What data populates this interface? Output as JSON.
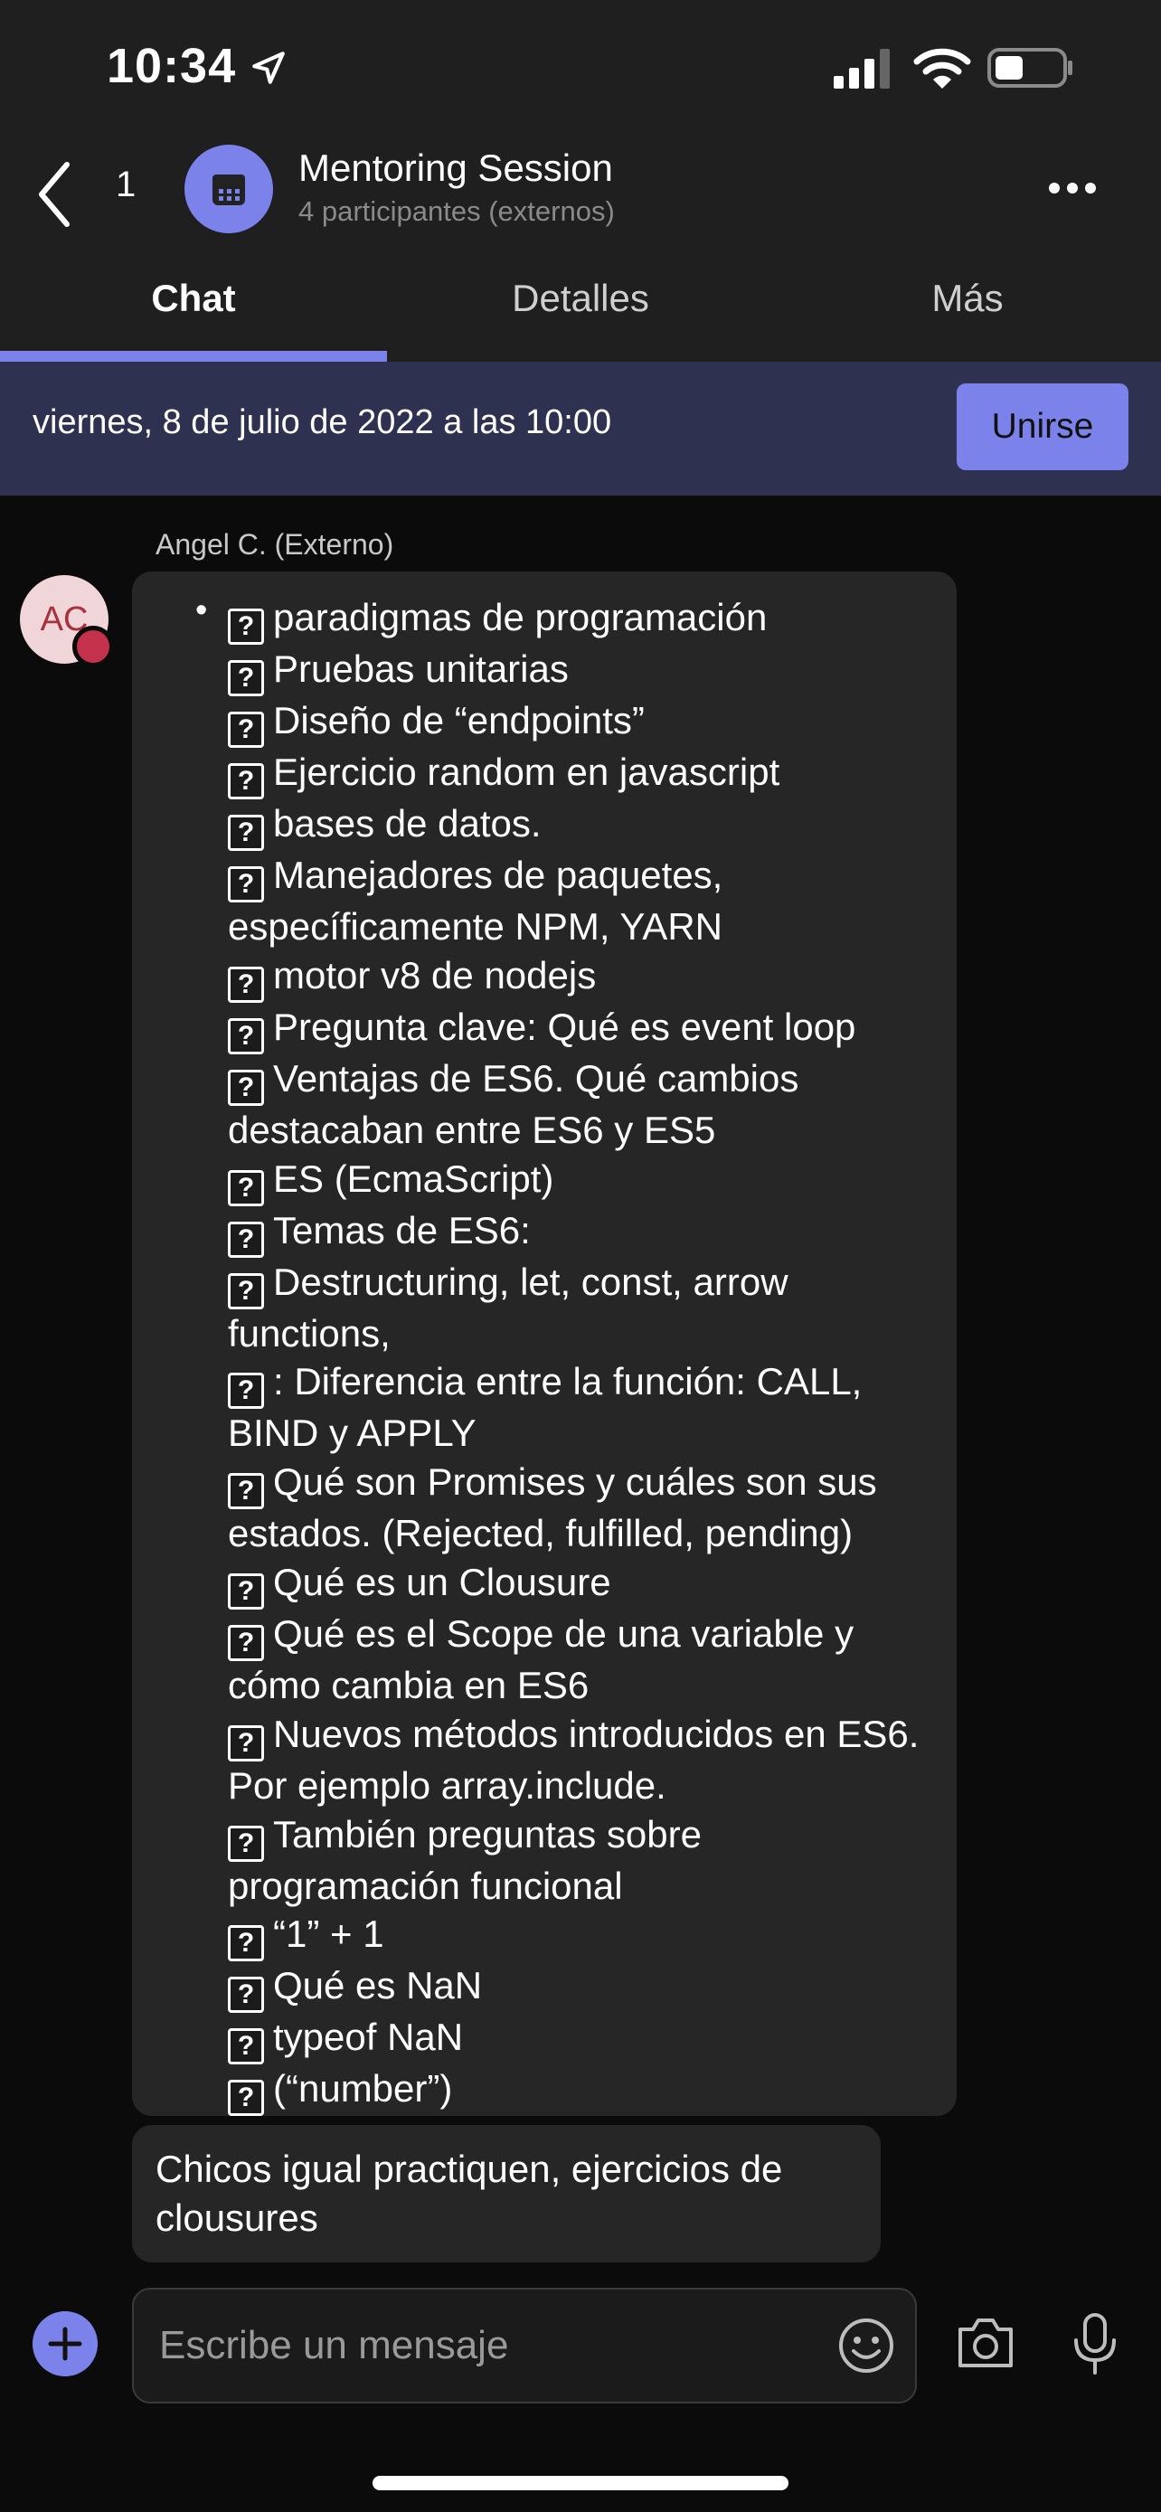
{
  "status_bar": {
    "time": "10:34"
  },
  "header": {
    "back_count": "1",
    "title": "Mentoring Session",
    "subtitle": "4 participantes (externos)"
  },
  "tabs": [
    {
      "label": "Chat",
      "active": true
    },
    {
      "label": "Detalles",
      "active": false
    },
    {
      "label": "Más",
      "active": false
    }
  ],
  "banner": {
    "date_text": "viernes, 8 de julio de 2022 a las 10:00",
    "join_label": "Unirse"
  },
  "chat": {
    "sender_name": "Angel C. (Externo)",
    "sender_initials": "AC",
    "message_items": [
      "paradigmas de programación",
      "Pruebas unitarias",
      "Diseño de “endpoints”",
      "Ejercicio random en javascript",
      "bases de datos.",
      "Manejadores de paquetes, específicamente NPM, YARN",
      "motor v8 de nodejs",
      "Pregunta clave: Qué es event loop",
      "Ventajas de ES6. Qué cambios destacaban entre ES6 y ES5",
      "ES (EcmaScript)",
      "Temas de ES6:",
      "Destructuring, let, const, arrow functions,",
      ": Diferencia entre la función: CALL, BIND y APPLY",
      "Qué son Promises y cuáles son sus estados. (Rejected, fulfilled, pending)",
      "Qué es un Clousure",
      "Qué es el Scope de una variable y cómo cambia en ES6",
      "Nuevos métodos introducidos en ES6. Por ejemplo array.include.",
      "También preguntas sobre programación funcional",
      "“1” + 1",
      "Qué es NaN",
      "typeof NaN",
      "(“number”)"
    ],
    "second_message": "Chicos igual practiquen, ejercicios de clousures"
  },
  "compose": {
    "placeholder": "Escribe un mensaje"
  },
  "colors": {
    "accent": "#7b83eb",
    "banner_bg": "#2f3151",
    "bubble_bg": "#262626",
    "presence_busy": "#c4314b"
  }
}
